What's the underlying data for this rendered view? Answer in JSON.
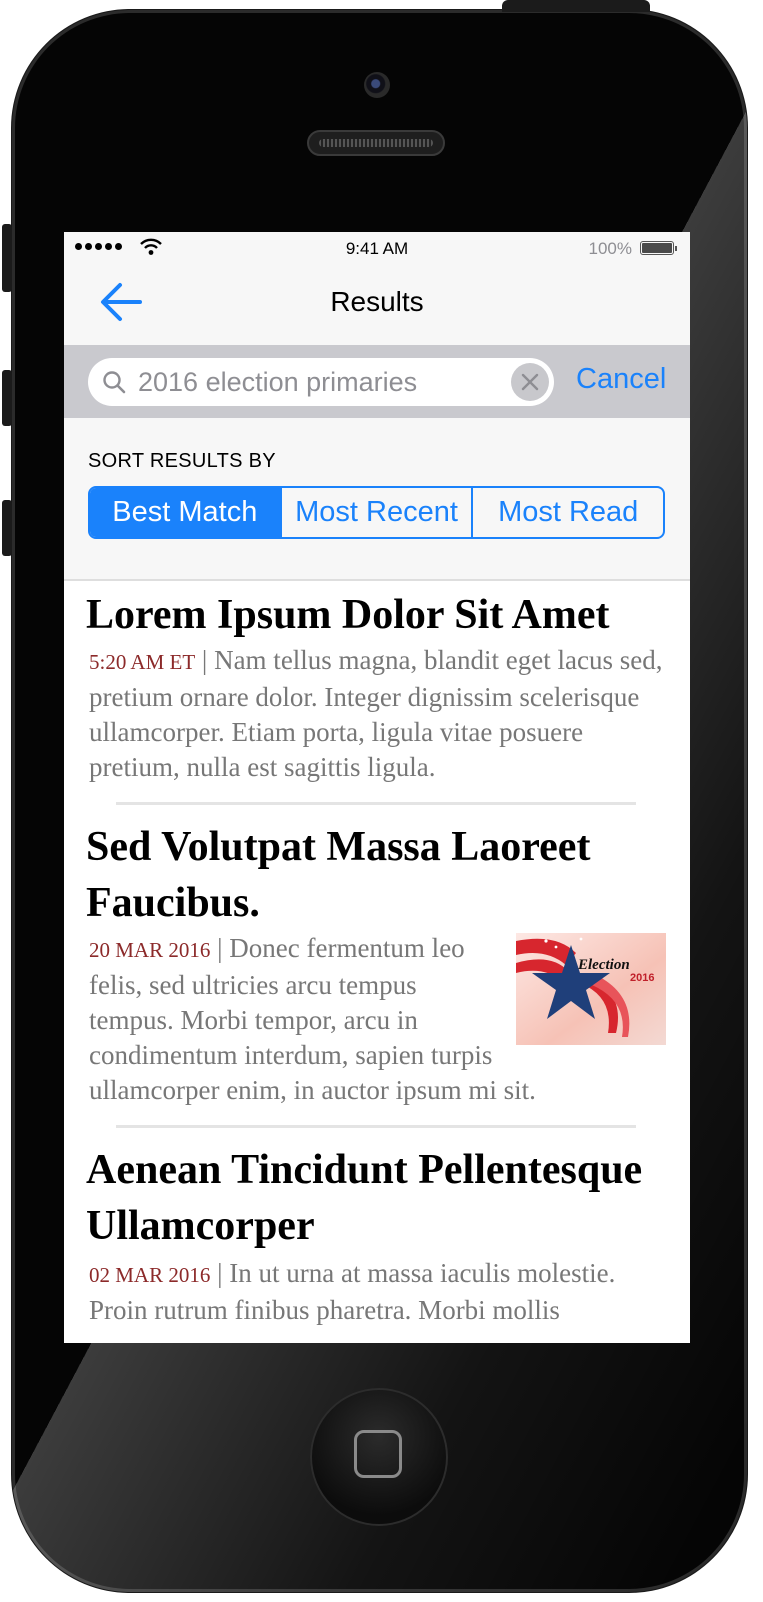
{
  "status_bar": {
    "time": "9:41 AM",
    "battery": "100%"
  },
  "nav": {
    "title": "Results"
  },
  "search": {
    "query": "2016 election primaries",
    "cancel": "Cancel"
  },
  "sort": {
    "label": "SORT RESULTS BY",
    "options": [
      "Best Match",
      "Most Recent",
      "Most Read"
    ],
    "selected": "Best Match"
  },
  "articles": [
    {
      "title": "Lorem Ipsum Dolor Sit Amet",
      "timestamp": "5:20 AM ET",
      "snippet": "Nam tellus magna, blandit eget lacus sed, pretium ornare dolor. Integer dignissim scelerisque ullamcorper. Etiam porta, ligula vitae posuere pretium, nulla est sagittis ligula."
    },
    {
      "title": "Sed Volutpat Massa Laoreet Faucibus.",
      "timestamp": "20 MAR 2016",
      "snippet": "Donec fermentum leo felis, sed ultricies arcu tempus tempus. Morbi tempor, arcu in condimentum interdum, sapien turpis ullamcorper enim, in auctor ipsum mi sit.",
      "thumbnail": {
        "text": "Election",
        "year": "2016"
      }
    },
    {
      "title": "Aenean Tincidunt Pellentesque Ullamcorper",
      "timestamp": "02 MAR 2016",
      "snippet": "In ut urna at massa iaculis molestie. Proin rutrum finibus pharetra. Morbi mollis"
    }
  ],
  "colors": {
    "accent": "#1a82fb",
    "timestamp": "#8c2a2a"
  },
  "icons": [
    "back-arrow-icon",
    "search-icon",
    "clear-icon",
    "wifi-icon",
    "battery-icon"
  ]
}
